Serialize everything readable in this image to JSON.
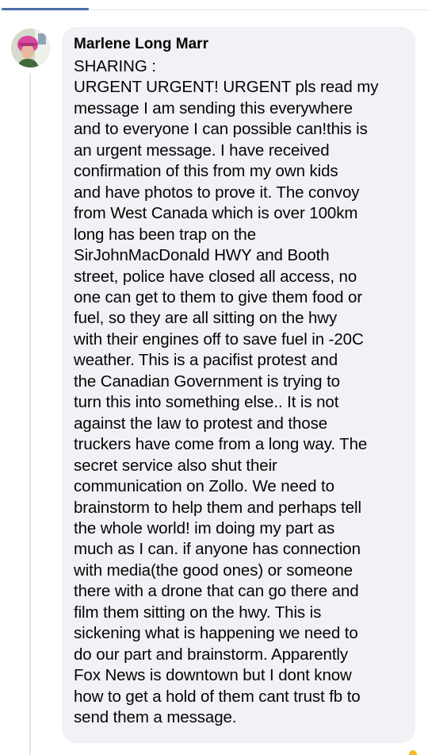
{
  "comment": {
    "author": "Marlene Long Marr",
    "text": "SHARING :\nURGENT URGENT! URGENT pls read my\nmessage I am sending this everywhere\nand to everyone I can possible can!this is\nan urgent message. I have received\nconfirmation of this from my own kids\nand have photos to prove it. The convoy\nfrom West Canada which is over 100km\nlong has been trap on the\nSirJohnMacDonald HWY and Booth\nstreet, police have closed all access, no\none can get to them to give them food or\nfuel, so they are all sitting on the hwy\nwith their engines off to save fuel in -20C\nweather. This is a pacifist protest and\nthe Canadian Government is trying to\nturn this into something else..  It is not\nagainst the law to protest and those\ntruckers have come from a long way. The\nsecret service also shut their\ncommunication on Zollo. We need to\nbrainstorm to help them and perhaps tell\nthe whole world! im doing my part as\nmuch as I can. if anyone has connection\nwith media(the good ones) or someone\nthere with a drone that can go there and\nfilm them sitting on the hwy. This is\nsickening what is happening we need to\ndo our part and brainstorm. Apparently\nFox News is downtown but I dont know\nhow to get a hold of them cant trust fb to\nsend them a message."
  },
  "colors": {
    "bubble": "#f0f2f5",
    "text": "#050505",
    "accent": "#4a6ea9",
    "reaction": "#f7b928"
  },
  "icons": {
    "avatar": "profile-photo",
    "reaction": "reaction-icon"
  }
}
